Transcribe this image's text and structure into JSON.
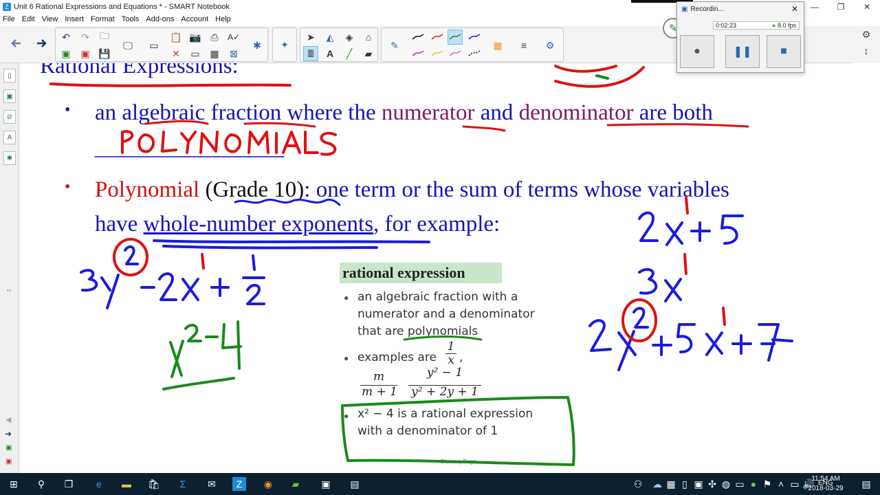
{
  "window": {
    "title": "Unit 6 Rational Expressions and Equations * - SMART Notebook"
  },
  "menu": [
    "File",
    "Edit",
    "View",
    "Insert",
    "Format",
    "Tools",
    "Add-ons",
    "Account",
    "Help"
  ],
  "recorder": {
    "title": "Recordin...",
    "elapsed": "0:02:23",
    "fps": "8.0 fps"
  },
  "slide": {
    "heading": "Rational Expressions:",
    "bullet1": {
      "pre": "an ",
      "w_algebraic": "algebraic",
      "mid1": " ",
      "w_fraction": "fraction",
      "mid2": " where the ",
      "w_numerator": "numerator",
      "mid3": " and ",
      "w_denominator": "denominator",
      "post": " are both"
    },
    "bullet2": {
      "w_polynomial": "Polynomial",
      "grade": " (Grade 10)",
      "post": ": one term or the sum of terms whose variables",
      "line2_pre": "have ",
      "line2_link": "whole-number exponents",
      "line2_post": ", for example:"
    },
    "handwriting": {
      "polynomials": "POLYNOMIALS"
    }
  },
  "textbook": {
    "heading": "rational expression",
    "b1_l1": "an algebraic fraction with a",
    "b1_l2": "numerator and a denominator",
    "b1_l3": "that are polynomials",
    "b2_l1": "examples are",
    "ex1_num": "1",
    "ex1_den": "x",
    "ex2_num": "m",
    "ex2_den": "m + 1",
    "ex3_num": "y² − 1",
    "ex3_den": "y² + 2y + 1",
    "b3_l1": "x² − 4 is a rational expression",
    "b3_l2": "with a denominator of 1",
    "footer_link": "Glossary Page"
  },
  "taskbar": {
    "time": "11:54 AM",
    "date": "2018-03-29",
    "lang": "ENG"
  },
  "colors": {
    "typed_blue": "#1414b8",
    "typed_purple": "#801a60",
    "typed_red": "#d01010",
    "ink_red": "#e01010",
    "ink_blue": "#1b1be0",
    "ink_green": "#1a8a1a",
    "glossary_header": "#c9e6cc"
  }
}
